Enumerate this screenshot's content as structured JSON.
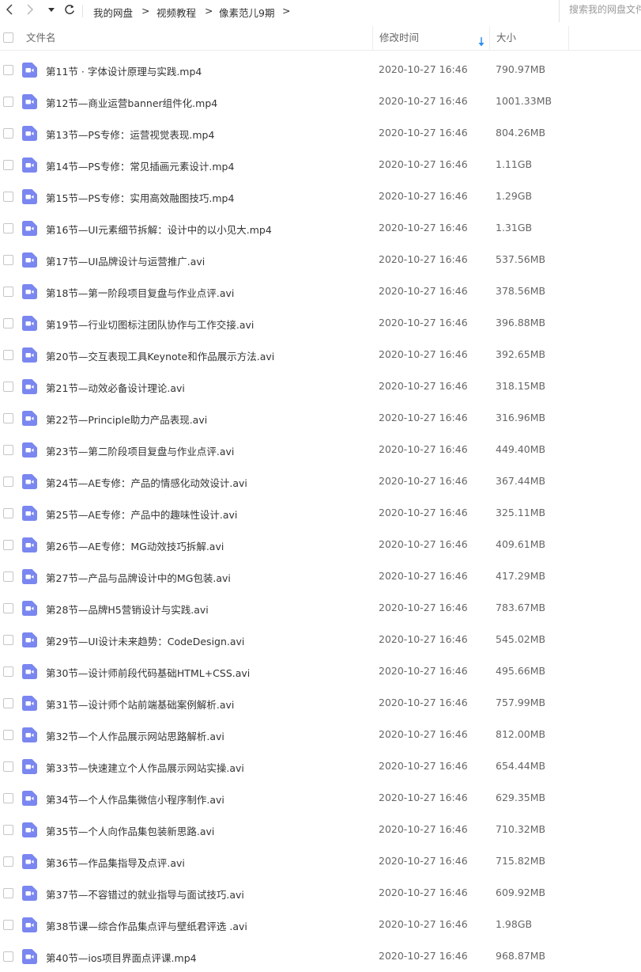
{
  "toolbar": {
    "back_icon": "chevron-left-icon",
    "forward_icon": "chevron-right-icon",
    "history_icon": "caret-down-icon",
    "refresh_icon": "refresh-icon",
    "breadcrumb": [
      {
        "label": "我的网盘"
      },
      {
        "label": "视频教程"
      },
      {
        "label": "像素范儿9期"
      }
    ],
    "separator": ">",
    "search_placeholder": "搜索我的网盘文件"
  },
  "columns": {
    "name": "文件名",
    "modified": "修改时间",
    "size": "大小",
    "sort_icon": "sort-descending-arrow-icon",
    "sort_color": "#2d8cf0"
  },
  "file_icon": {
    "name": "video-file-icon",
    "color": "#7a87f0"
  },
  "files": [
    {
      "name": "第11节 · 字体设计原理与实践.mp4",
      "modified": "2020-10-27 16:46",
      "size": "790.97MB"
    },
    {
      "name": "第12节—商业运营banner组件化.mp4",
      "modified": "2020-10-27 16:46",
      "size": "1001.33MB"
    },
    {
      "name": "第13节—PS专修：运营视觉表现.mp4",
      "modified": "2020-10-27 16:46",
      "size": "804.26MB"
    },
    {
      "name": "第14节—PS专修：常见插画元素设计.mp4",
      "modified": "2020-10-27 16:46",
      "size": "1.11GB"
    },
    {
      "name": "第15节—PS专修：实用高效融图技巧.mp4",
      "modified": "2020-10-27 16:46",
      "size": "1.29GB"
    },
    {
      "name": "第16节—UI元素细节拆解：设计中的以小见大.mp4",
      "modified": "2020-10-27 16:46",
      "size": "1.31GB"
    },
    {
      "name": "第17节—UI品牌设计与运营推广.avi",
      "modified": "2020-10-27 16:46",
      "size": "537.56MB"
    },
    {
      "name": "第18节—第一阶段项目复盘与作业点评.avi",
      "modified": "2020-10-27 16:46",
      "size": "378.56MB"
    },
    {
      "name": "第19节—行业切图标注团队协作与工作交接.avi",
      "modified": "2020-10-27 16:46",
      "size": "396.88MB"
    },
    {
      "name": "第20节—交互表现工具Keynote和作品展示方法.avi",
      "modified": "2020-10-27 16:46",
      "size": "392.65MB"
    },
    {
      "name": "第21节—动效必备设计理论.avi",
      "modified": "2020-10-27 16:46",
      "size": "318.15MB"
    },
    {
      "name": "第22节—Principle助力产品表现.avi",
      "modified": "2020-10-27 16:46",
      "size": "316.96MB"
    },
    {
      "name": "第23节—第二阶段项目复盘与作业点评.avi",
      "modified": "2020-10-27 16:46",
      "size": "449.40MB"
    },
    {
      "name": "第24节—AE专修：产品的情感化动效设计.avi",
      "modified": "2020-10-27 16:46",
      "size": "367.44MB"
    },
    {
      "name": "第25节—AE专修：产品中的趣味性设计.avi",
      "modified": "2020-10-27 16:46",
      "size": "325.11MB"
    },
    {
      "name": "第26节—AE专修：MG动效技巧拆解.avi",
      "modified": "2020-10-27 16:46",
      "size": "409.61MB"
    },
    {
      "name": "第27节—产品与品牌设计中的MG包装.avi",
      "modified": "2020-10-27 16:46",
      "size": "417.29MB"
    },
    {
      "name": "第28节—品牌H5营销设计与实践.avi",
      "modified": "2020-10-27 16:46",
      "size": "783.67MB"
    },
    {
      "name": "第29节—UI设计未来趋势：CodeDesign.avi",
      "modified": "2020-10-27 16:46",
      "size": "545.02MB"
    },
    {
      "name": "第30节—设计师前段代码基础HTML+CSS.avi",
      "modified": "2020-10-27 16:46",
      "size": "495.66MB"
    },
    {
      "name": "第31节—设计师个站前端基础案例解析.avi",
      "modified": "2020-10-27 16:46",
      "size": "757.99MB"
    },
    {
      "name": "第32节—个人作品展示网站思路解析.avi",
      "modified": "2020-10-27 16:46",
      "size": "812.00MB"
    },
    {
      "name": "第33节—快速建立个人作品展示网站实操.avi",
      "modified": "2020-10-27 16:46",
      "size": "654.44MB"
    },
    {
      "name": "第34节—个人作品集微信小程序制作.avi",
      "modified": "2020-10-27 16:46",
      "size": "629.35MB"
    },
    {
      "name": "第35节—个人向作品集包装新思路.avi",
      "modified": "2020-10-27 16:46",
      "size": "710.32MB"
    },
    {
      "name": "第36节—作品集指导及点评.avi",
      "modified": "2020-10-27 16:46",
      "size": "715.82MB"
    },
    {
      "name": "第37节—不容错过的就业指导与面试技巧.avi",
      "modified": "2020-10-27 16:46",
      "size": "609.92MB"
    },
    {
      "name": "第38节课—综合作品集点评与壁纸君评选 .avi",
      "modified": "2020-10-27 16:46",
      "size": "1.98GB"
    },
    {
      "name": "第40节—ios项目界面点评课.mp4",
      "modified": "2020-10-27 16:46",
      "size": "968.87MB"
    }
  ]
}
